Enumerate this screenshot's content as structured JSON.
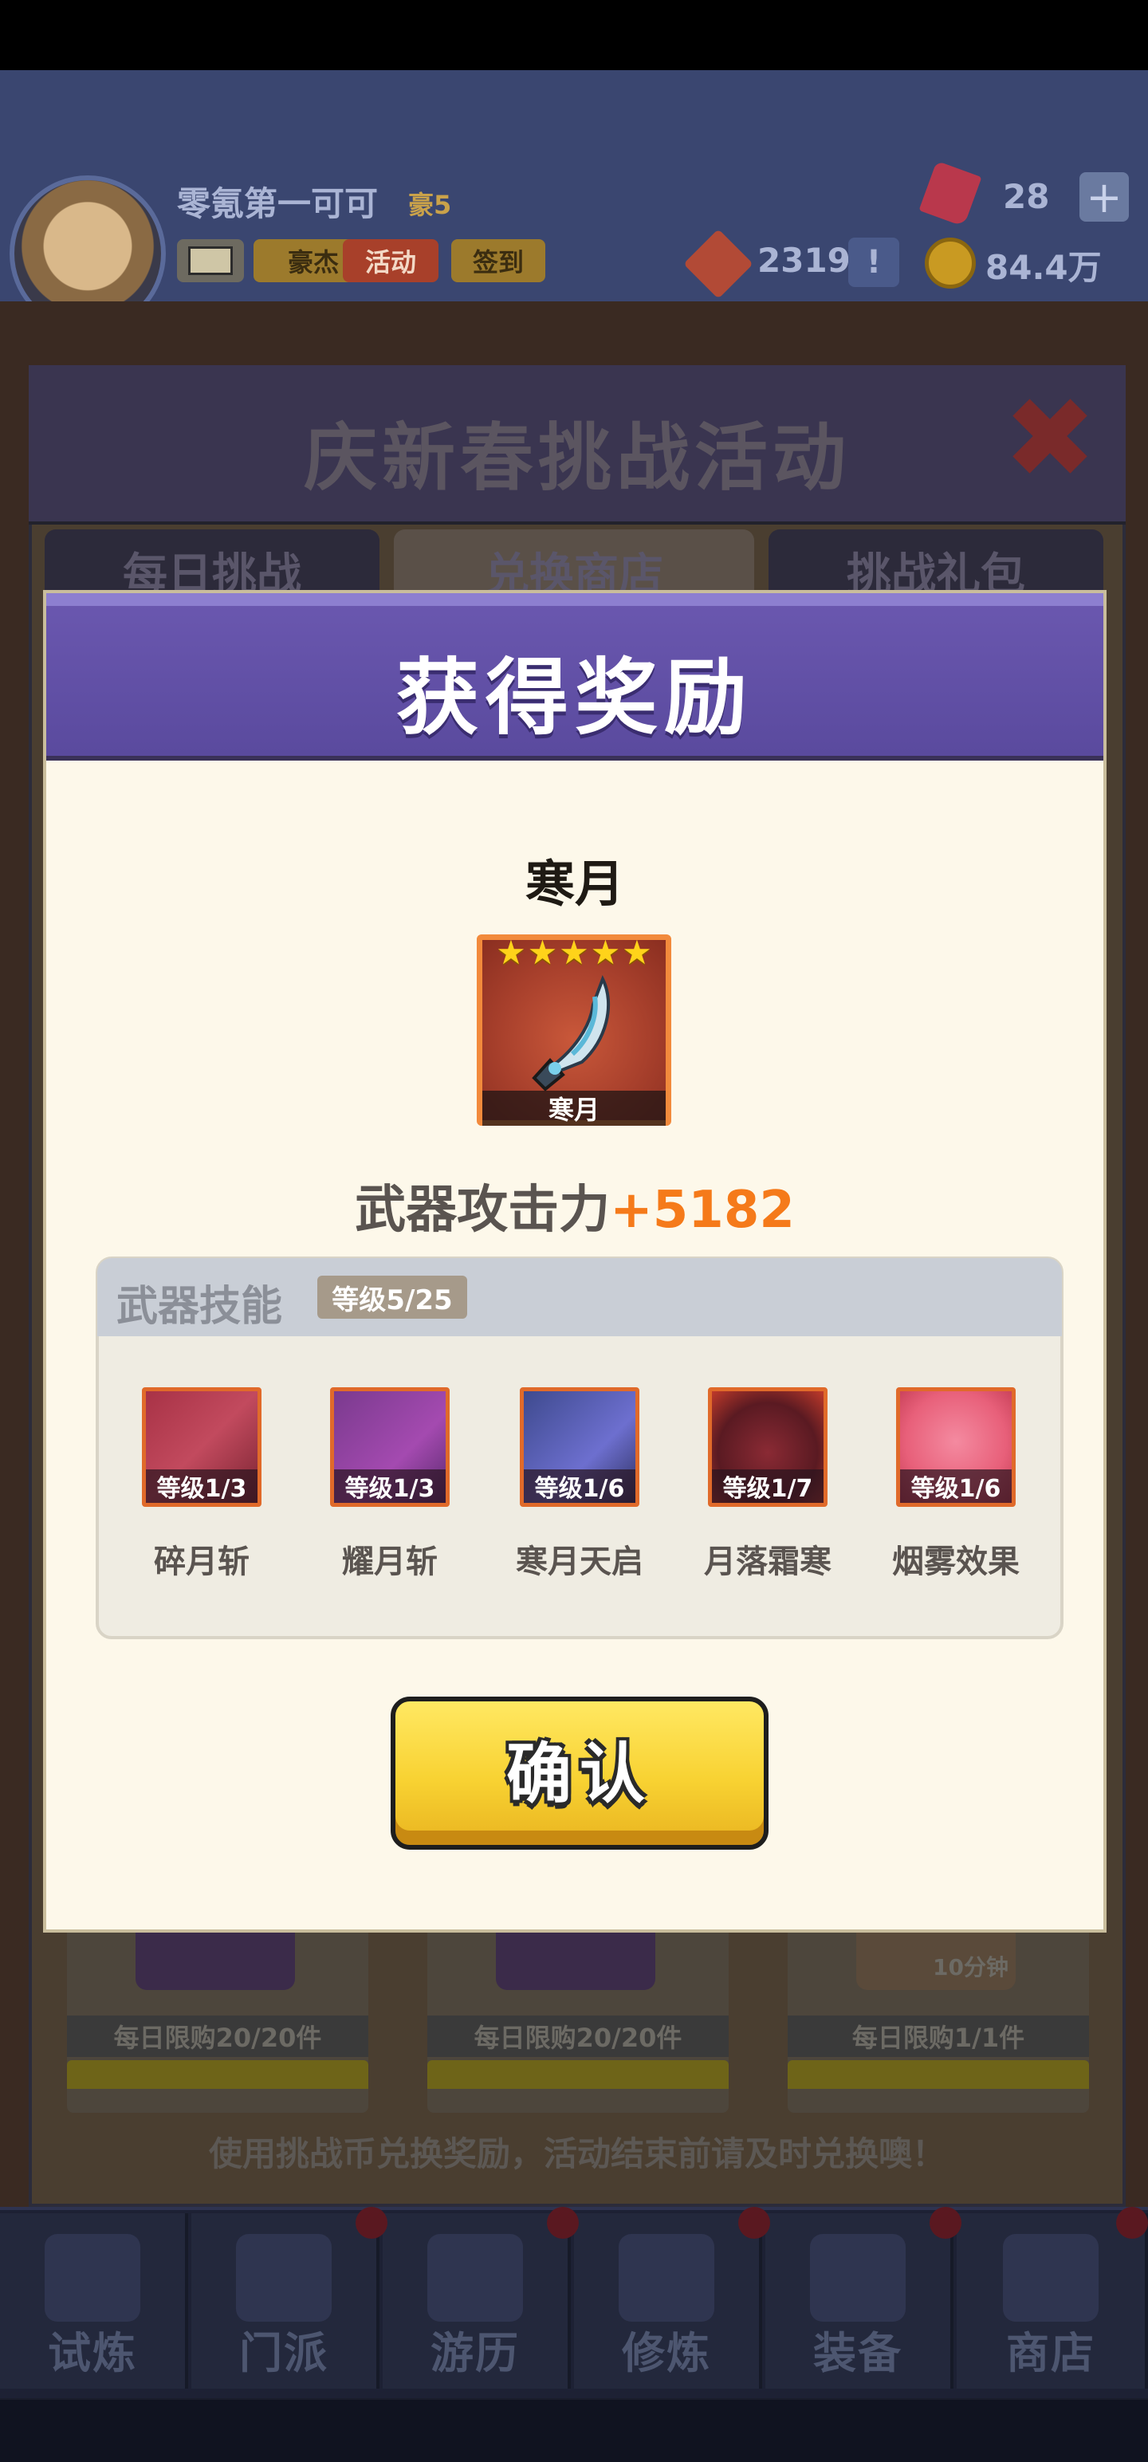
{
  "hud": {
    "player_name": "零氪第一可可",
    "vip_level": "豪5",
    "chips": {
      "haojie": "豪杰",
      "activity": "活动",
      "signin": "签到"
    },
    "gems": "28",
    "plus": "+",
    "tokens": "2319",
    "alert": "!",
    "coins": "84.4万"
  },
  "event_panel": {
    "title": "庆新春挑战活动",
    "close": "✖",
    "tabs": [
      "每日挑战",
      "兑换商店",
      "挑战礼包"
    ],
    "shop_limits": [
      "每日限购20/20件",
      "每日限购20/20件",
      "每日限购1/1件"
    ],
    "timer_tag": "10分钟",
    "footer_note": "使用挑战币兑换奖励，活动结束前请及时兑换噢！"
  },
  "reward_modal": {
    "title": "获得奖励",
    "item_name": "寒月",
    "item_card_label": "寒月",
    "stars": [
      "★",
      "★",
      "★",
      "★",
      "★"
    ],
    "attack_label": "武器攻击力",
    "attack_bonus": "+5182",
    "skills_title": "武器技能",
    "skills_level": "等级5/25",
    "skills": [
      {
        "name": "碎月斩",
        "level": "等级1/3"
      },
      {
        "name": "耀月斩",
        "level": "等级1/3"
      },
      {
        "name": "寒月天启",
        "level": "等级1/6"
      },
      {
        "name": "月落霜寒",
        "level": "等级1/7"
      },
      {
        "name": "烟雾效果",
        "level": "等级1/6"
      }
    ],
    "confirm_label": "确认"
  },
  "bottom_nav": [
    "试炼",
    "门派",
    "游历",
    "修炼",
    "装备",
    "商店"
  ],
  "colors": {
    "modal_header": "#5a4a9e",
    "attack_bonus": "#f57a1a",
    "confirm_button": "#f8d232",
    "skill_border": "#e06a2a"
  }
}
